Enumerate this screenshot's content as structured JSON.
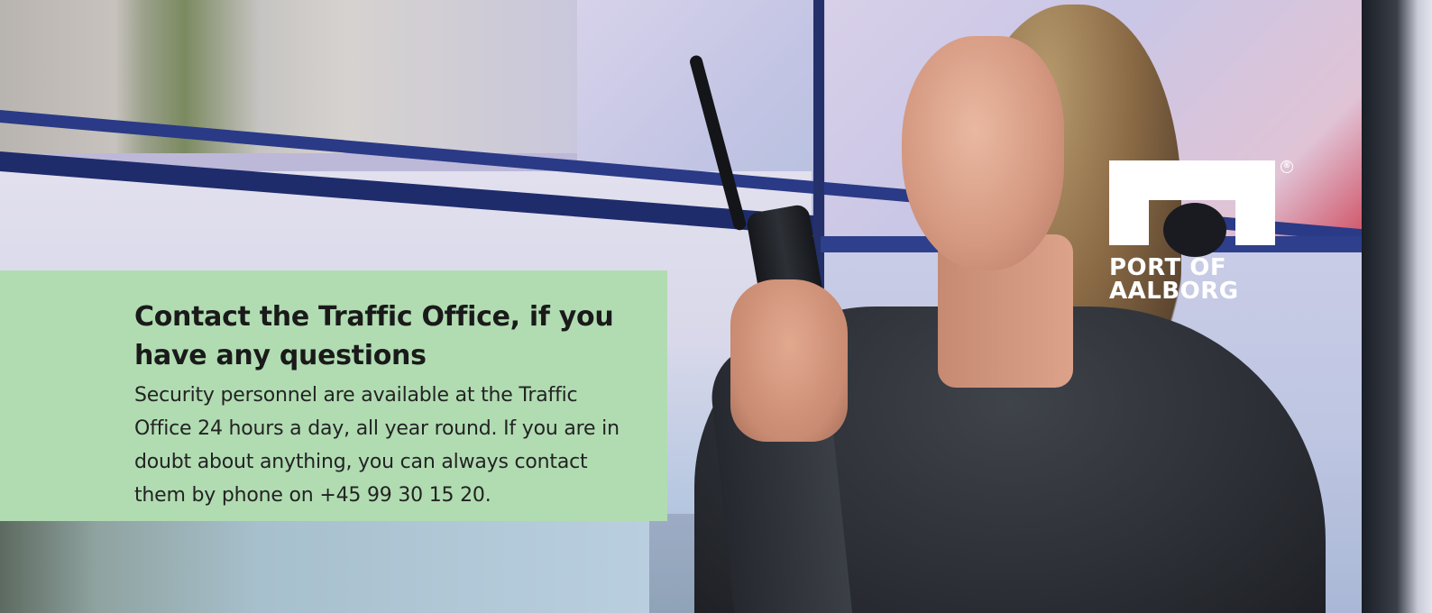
{
  "hero": {
    "image_subject": "person-with-radio-in-control-room"
  },
  "logo": {
    "line1": "PORT OF",
    "line2": "AALBORG",
    "registered_mark": "®",
    "color": "#ffffff"
  },
  "card": {
    "background": "#b1dcb2",
    "title": "Contact the Traffic Office, if you have any questions",
    "body": "Security personnel are available at the Traffic Office 24 hours a day, all year round. If you are in doubt about anything, you can always contact them by phone on +45 99 30 15 20."
  }
}
